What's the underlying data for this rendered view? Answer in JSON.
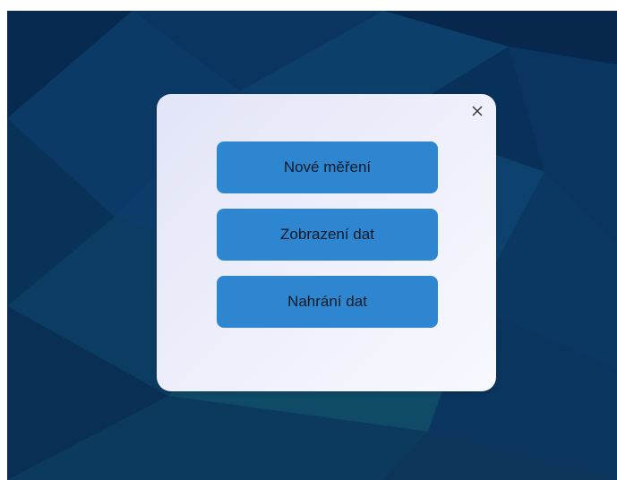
{
  "dialog": {
    "close_icon": "close-icon",
    "buttons": [
      {
        "label": "Nové měření"
      },
      {
        "label": "Zobrazení dat"
      },
      {
        "label": "Nahrání dat"
      }
    ]
  },
  "colors": {
    "background": "#08315a",
    "dialog_start": "#e2e5f7",
    "dialog_end": "#f8f8fe",
    "button": "#2f86d0",
    "button_text": "#0f1a26"
  }
}
